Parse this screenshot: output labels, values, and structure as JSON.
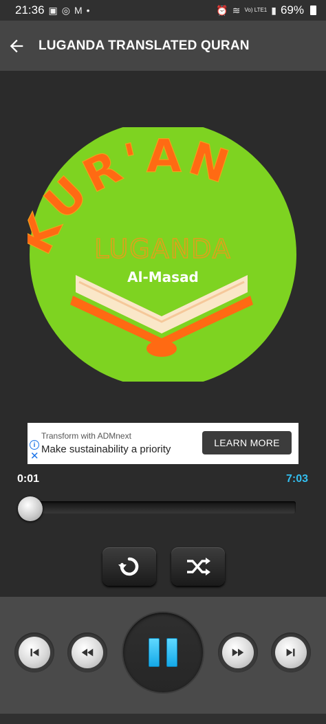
{
  "status": {
    "time": "21:36",
    "battery": "69%",
    "network": "Vo) LTE1"
  },
  "appbar": {
    "title": "LUGANDA TRANSLATED QURAN"
  },
  "art": {
    "kuran": "KUR'AN",
    "luganda": "LUGANDA",
    "surah": "Al-Masad"
  },
  "ad": {
    "small": "Transform with ADMnext",
    "big": "Make sustainability a priority",
    "cta": "LEARN MORE"
  },
  "player": {
    "current": "0:01",
    "total": "7:03",
    "progress": 0.002
  },
  "colors": {
    "accent": "#33bff0",
    "circle": "#7ed321",
    "orange": "#ff6a13"
  },
  "icons": [
    "back-arrow-icon",
    "repeat-icon",
    "shuffle-icon",
    "skip-previous-icon",
    "rewind-icon",
    "pause-icon",
    "fast-forward-icon",
    "skip-next-icon"
  ]
}
